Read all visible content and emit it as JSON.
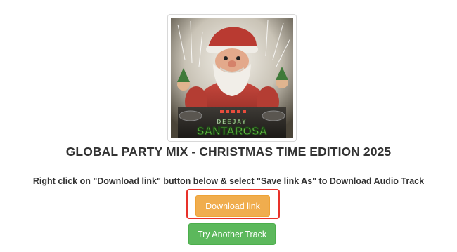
{
  "cover": {
    "image_alt": "Deejay Santarosa — Santa Claus DJ cover art",
    "logo_line1": "DEEJAY",
    "logo_line2": "SANTAROSA"
  },
  "title": "GLOBAL PARTY MIX - CHRISTMAS TIME EDITION 2025",
  "instruction": "Right click on \"Download link\" button below & select \"Save link As\" to Download Audio Track",
  "buttons": {
    "download_label": "Download link",
    "try_another_label": "Try Another Track"
  },
  "colors": {
    "download_button": "#f0ad4e",
    "try_button": "#5cb85c",
    "highlight_outline": "#e8312a",
    "text": "#333333"
  }
}
